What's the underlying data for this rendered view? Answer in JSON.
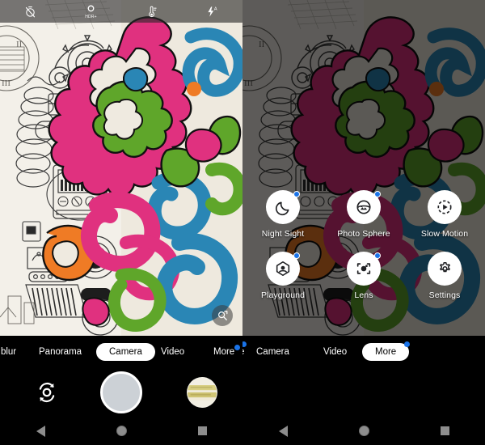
{
  "app": {
    "name": "Camera",
    "panels": [
      {
        "id": "left",
        "state_label": "Camera mode viewfinder"
      },
      {
        "id": "right",
        "state_label": "More menu expanded"
      }
    ]
  },
  "status_bar": {
    "items": [
      {
        "name": "timer-off-icon",
        "label": "Timer off"
      },
      {
        "name": "hdr-plus-icon",
        "label": "HDR+"
      },
      {
        "name": "white-balance-icon",
        "label": "White balance"
      },
      {
        "name": "flash-auto-icon",
        "label": "Flash auto",
        "sub_label": "A"
      }
    ]
  },
  "viewfinder": {
    "zoom_button_label": "Zoom",
    "subject": "Colorful illustrated brain mural artwork"
  },
  "more_menu": {
    "items": [
      {
        "label": "Night Sight",
        "icon": "moon-icon",
        "badge": true
      },
      {
        "label": "Photo Sphere",
        "icon": "photo-sphere-icon",
        "badge": true
      },
      {
        "label": "Slow Motion",
        "icon": "slow-motion-icon",
        "badge": false
      },
      {
        "label": "Playground",
        "icon": "playground-icon",
        "badge": true
      },
      {
        "label": "Lens",
        "icon": "lens-icon",
        "badge": true
      },
      {
        "label": "Settings",
        "icon": "gear-icon",
        "badge": false
      }
    ]
  },
  "mode_selector": {
    "left_panel": {
      "modes": [
        {
          "label": "s blur",
          "selected": false,
          "badge": false,
          "clipped": true
        },
        {
          "label": "Panorama",
          "selected": false,
          "badge": false
        },
        {
          "label": "Camera",
          "selected": true,
          "badge": false
        },
        {
          "label": "Video",
          "selected": false,
          "badge": false
        },
        {
          "label": "More",
          "selected": false,
          "badge": true
        }
      ]
    },
    "right_panel": {
      "modes": [
        {
          "label": "e",
          "selected": false,
          "badge": true,
          "clipped": true
        },
        {
          "label": "Camera",
          "selected": false,
          "badge": false
        },
        {
          "label": "Video",
          "selected": false,
          "badge": false
        },
        {
          "label": "More",
          "selected": true,
          "badge": true
        }
      ]
    }
  },
  "shutter_bar": {
    "flip_camera_label": "Switch camera",
    "shutter_label": "Take photo",
    "gallery_thumb_label": "Last photo"
  },
  "nav_bar": {
    "back_label": "Back",
    "home_label": "Home",
    "recents_label": "Recent apps"
  },
  "colors": {
    "accent_blue": "#1a73e8",
    "shutter_fill": "#ccd1d6",
    "panel_black": "#000000",
    "nav_icon": "#8d8d8d",
    "art_magenta": "#e0317f",
    "art_green": "#5fa62a",
    "art_blue": "#2a86b5",
    "art_orange": "#ef7b25",
    "art_paper": "#eee9de"
  }
}
